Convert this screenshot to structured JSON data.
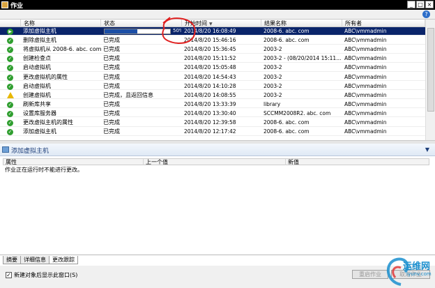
{
  "window": {
    "title": "作业",
    "controls": {
      "minimize": "_",
      "maximize": "□",
      "close": "×"
    },
    "help": "?"
  },
  "grid": {
    "columns": {
      "name": "名称",
      "status": "状态",
      "start_time": "开始时间",
      "result_name": "结果名称",
      "owner": "所有者"
    },
    "sort_indicator": "▼",
    "rows": [
      {
        "icon": "running-icon",
        "name": "添加虚拟主机",
        "status": "",
        "progress_pct": 50,
        "progress_label": "50%",
        "start_time": "2014/8/20 16:08:49",
        "result": "2008-6. abc. com",
        "owner": "ABC\\vmmadmin",
        "selected": true
      },
      {
        "icon": "success-icon",
        "name": "删除虚拟主机",
        "status": "已完成",
        "start_time": "2014/8/20 15:46:16",
        "result": "2008-6. abc. com",
        "owner": "ABC\\vmmadmin"
      },
      {
        "icon": "success-icon",
        "name": "将虚拟机从 2008-6. abc. com ...",
        "status": "已完成",
        "start_time": "2014/8/20 15:36:45",
        "result": "2003-2",
        "owner": "ABC\\vmmadmin"
      },
      {
        "icon": "success-icon",
        "name": "创建检查点",
        "status": "已完成",
        "start_time": "2014/8/20 15:11:52",
        "result": "2003-2 - (08/20/2014 15:11...",
        "owner": "ABC\\vmmadmin"
      },
      {
        "icon": "success-icon",
        "name": "启动虚拟机",
        "status": "已完成",
        "start_time": "2014/8/20 15:05:48",
        "result": "2003-2",
        "owner": "ABC\\vmmadmin"
      },
      {
        "icon": "success-icon",
        "name": "更改虚拟机的属性",
        "status": "已完成",
        "start_time": "2014/8/20 14:54:43",
        "result": "2003-2",
        "owner": "ABC\\vmmadmin"
      },
      {
        "icon": "success-icon",
        "name": "启动虚拟机",
        "status": "已完成",
        "start_time": "2014/8/20 14:10:28",
        "result": "2003-2",
        "owner": "ABC\\vmmadmin"
      },
      {
        "icon": "warning-icon",
        "name": "创建虚拟机",
        "status": "已完成，且返回信息",
        "start_time": "2014/8/20 14:08:55",
        "result": "2003-2",
        "owner": "ABC\\vmmadmin"
      },
      {
        "icon": "success-icon",
        "name": "刷新库共享",
        "status": "已完成",
        "start_time": "2014/8/20 13:33:39",
        "result": "library",
        "owner": "ABC\\vmmadmin"
      },
      {
        "icon": "success-icon",
        "name": "设置库服务器",
        "status": "已完成",
        "start_time": "2014/8/20 13:30:40",
        "result": "SCCMM2008R2. abc. com",
        "owner": "ABC\\vmmadmin"
      },
      {
        "icon": "success-icon",
        "name": "更改虚拟主机的属性",
        "status": "已完成",
        "start_time": "2014/8/20 12:39:58",
        "result": "2008-6. abc. com",
        "owner": "ABC\\vmmadmin"
      },
      {
        "icon": "success-icon",
        "name": "添加虚拟主机",
        "status": "已完成",
        "start_time": "2014/8/20 12:17:42",
        "result": "2008-6. abc. com",
        "owner": "ABC\\vmmadmin"
      }
    ]
  },
  "detail": {
    "title": "添加虚拟主机",
    "columns": {
      "property": "属性",
      "previous": "上一个值",
      "new": "新值"
    },
    "message": "作业正在运行时不能进行更改。"
  },
  "tabs": [
    {
      "label": "摘要",
      "active": false
    },
    {
      "label": "详细信息",
      "active": false
    },
    {
      "label": "更改跟踪",
      "active": true
    }
  ],
  "footer": {
    "checkbox_label": "新建对象后显示此窗口(S)",
    "checkbox_checked": "✓",
    "restart_button": "重启作业",
    "cancel_button": "取消作业"
  },
  "watermark": {
    "text": "运维网",
    "sub": "iyunv.com"
  },
  "colors": {
    "selection": "#0a246a",
    "progress": "#1c4fa6",
    "annotation": "#e02020",
    "watermark": "#1a8fcf"
  }
}
